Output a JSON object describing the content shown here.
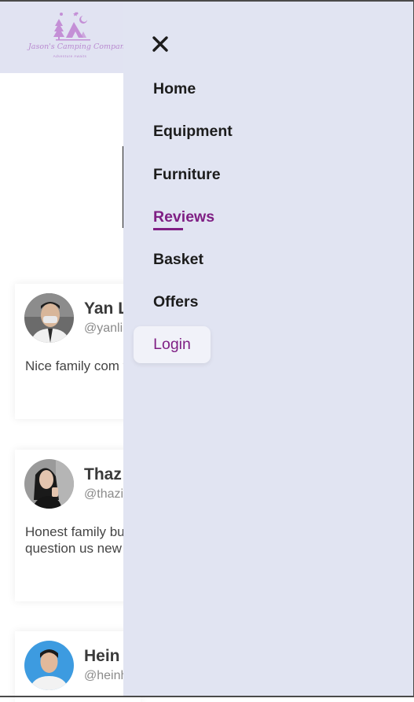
{
  "logo": {
    "title": "Jason's Camping Company",
    "subtitle": "Adventure Awaits"
  },
  "reviews": [
    {
      "name": "Yan L",
      "handle": "@yanlin",
      "text": "Nice family com to get our new c"
    },
    {
      "name": "Thaz",
      "handle": "@thazi",
      "text": "Honest family bu do quality work question us new"
    },
    {
      "name": "Hein",
      "handle": "@heinh",
      "text": ""
    }
  ],
  "nav": {
    "items": [
      {
        "label": "Home"
      },
      {
        "label": "Equipment"
      },
      {
        "label": "Furniture"
      },
      {
        "label": "Reviews",
        "active": true
      },
      {
        "label": "Basket"
      },
      {
        "label": "Offers"
      }
    ],
    "login_label": "Login"
  },
  "icons": {
    "close": "close-icon",
    "logo": "camp-tent-logo-icon"
  },
  "colors": {
    "accent": "#7f1f84",
    "header_bg": "#e1e3f2",
    "drawer_bg": "#e1e4f2"
  }
}
